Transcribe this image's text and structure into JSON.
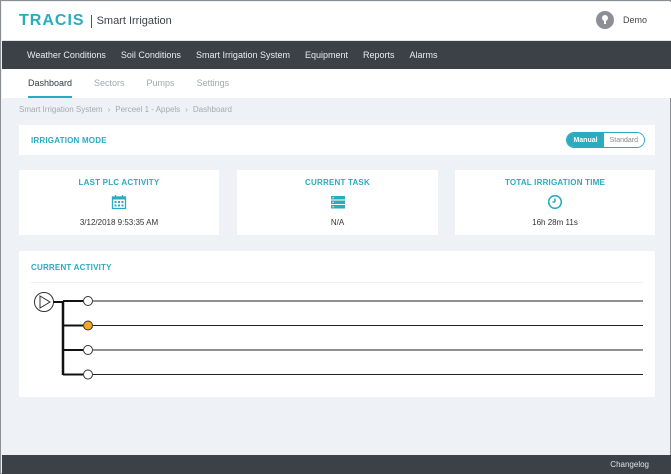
{
  "header": {
    "brand": "TRACIS",
    "product": "Smart Irrigation",
    "user_name": "Demo"
  },
  "main_nav": [
    "Weather Conditions",
    "Soil Conditions",
    "Smart Irrigation System",
    "Equipment",
    "Reports",
    "Alarms"
  ],
  "sub_nav": {
    "items": [
      "Dashboard",
      "Sectors",
      "Pumps",
      "Settings"
    ],
    "active": "Dashboard"
  },
  "breadcrumb": [
    "Smart Irrigation System",
    "Perceel 1 - Appels",
    "Dashboard"
  ],
  "irrigation_mode": {
    "title": "IRRIGATION MODE",
    "options": [
      "Manual",
      "Standard"
    ],
    "selected": "Manual"
  },
  "stats": {
    "last_plc": {
      "title": "LAST PLC ACTIVITY",
      "icon": "calendar-icon",
      "value": "3/12/2018 9:53:35 AM"
    },
    "current_task": {
      "title": "CURRENT TASK",
      "icon": "server-icon",
      "value": "N/A"
    },
    "total_time": {
      "title": "TOTAL IRRIGATION TIME",
      "icon": "clock-icon",
      "value": "16h 28m 11s"
    }
  },
  "current_activity": {
    "title": "CURRENT ACTIVITY",
    "pump_icon": "play-icon",
    "sectors": [
      {
        "active": false
      },
      {
        "active": true
      },
      {
        "active": false
      },
      {
        "active": false
      }
    ]
  },
  "footer": {
    "link": "Changelog"
  },
  "colors": {
    "accent": "#2aabc0",
    "active_sector": "#f5a623",
    "nav_bg": "#3c4148",
    "page_bg": "#eef1f5"
  }
}
